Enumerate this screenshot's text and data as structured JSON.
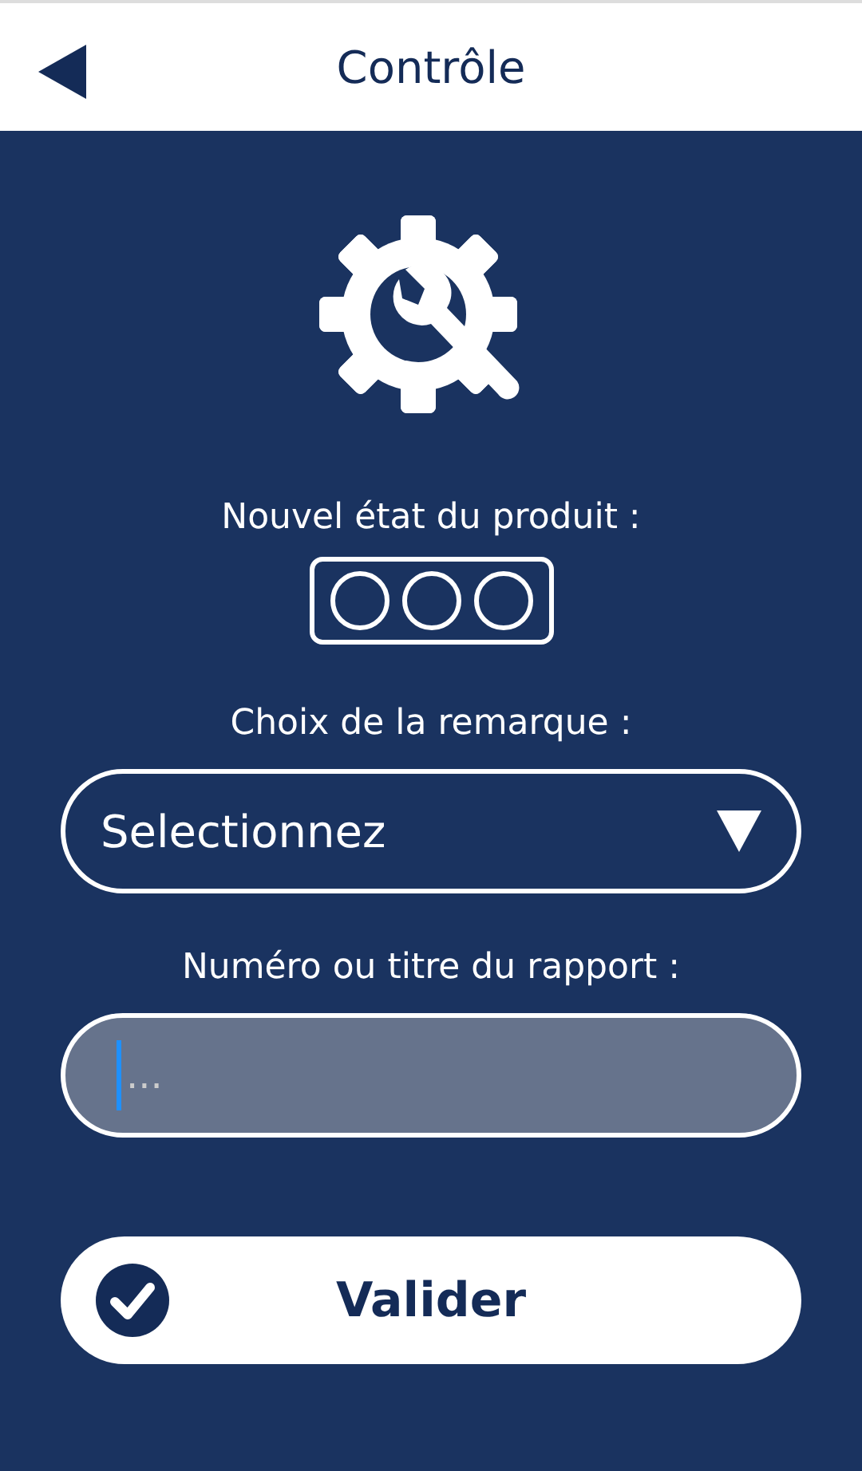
{
  "header": {
    "title": "Contrôle"
  },
  "state_label": "Nouvel état du produit :",
  "state_options": [
    {
      "selected": false
    },
    {
      "selected": false
    },
    {
      "selected": false
    }
  ],
  "remark_label": "Choix de la remarque :",
  "remark_select": {
    "value": "Selectionnez"
  },
  "report_label": "Numéro ou titre du rapport :",
  "report_field": {
    "placeholder": "..."
  },
  "submit_button": {
    "label": "Valider"
  }
}
